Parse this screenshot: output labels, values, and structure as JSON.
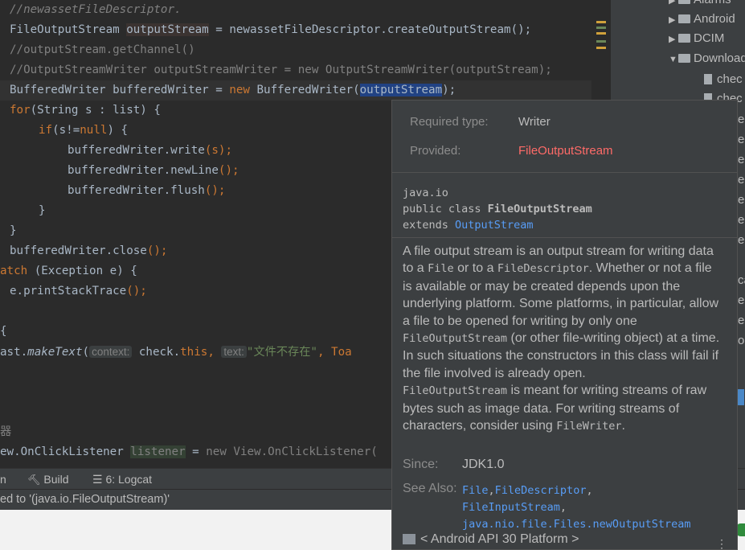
{
  "editor": {
    "l1": "//newassetFileDescriptor.",
    "l2a": "FileOutputStream ",
    "l2b": "outputStream",
    "l2c": " = newassetFileDescriptor.",
    "l2d": "createOutputStream",
    "l2e": "();",
    "l3": "//outputStream.getChannel()",
    "l4": "//OutputStreamWriter outputStreamWriter = new OutputStreamWriter(outputStream);",
    "l5a": "BufferedWriter bufferedWriter = ",
    "l5b": "new",
    "l5c": " BufferedWriter(",
    "l5d": "outputStream",
    "l5e": ");",
    "l6a": "for",
    "l6b": "(String s : list) {",
    "l7a": "if",
    "l7b": "(s!=",
    "l7c": "null",
    "l7d": ") {",
    "l8a": "bufferedWriter.",
    "l8b": "write",
    "l8c": "(s);",
    "l9a": "bufferedWriter.",
    "l9b": "newLine",
    "l9c": "();",
    "l10a": "bufferedWriter.",
    "l10b": "flush",
    "l10c": "();",
    "l11": "}",
    "l12": "}",
    "l13a": "bufferedWriter.",
    "l13b": "close",
    "l13c": "();",
    "l14a": "atch",
    "l14b": " (Exception e) {",
    "l15a": "e.",
    "l15b": "printStackTrace",
    "l15c": "();",
    "l16": "{",
    "l17a": "ast.",
    "l17b": "makeText",
    "l17c": "(",
    "l17hint1": "context:",
    "l17d": " check.",
    "l17e": "this",
    "l17f": ",",
    "l17hint2": "text:",
    "l17g": "\"文件不存在\"",
    "l17h": ", Toa",
    "l18": "器",
    "l19a": "ew.OnClickListener ",
    "l19b": "listener",
    "l19c": " = ",
    "l19d": "new View.OnClickListener(",
    "gutter_colors": [
      "#d0a13b",
      "#6a8759",
      "#d0a13b",
      "#6a8759"
    ]
  },
  "sidebar": {
    "items": [
      {
        "label": "Alarms",
        "type": "folder"
      },
      {
        "label": "Android",
        "type": "folder"
      },
      {
        "label": "DCIM",
        "type": "folder"
      },
      {
        "label": "Download",
        "type": "folder-open"
      },
      {
        "label": "chec",
        "type": "file"
      },
      {
        "label": "chec",
        "type": "file"
      }
    ],
    "partial": [
      "ec",
      "ec",
      "ec",
      "ec",
      "ec",
      "ec",
      "ec",
      "ec",
      "ec",
      "ec",
      "ca",
      "es",
      "es",
      "or"
    ]
  },
  "toolbar": {
    "run_label": "n",
    "build_label": "Build",
    "logcat_label": "6: Logcat"
  },
  "status": {
    "text": "ed to '(java.io.FileOutputStream)'"
  },
  "popup": {
    "required_label": "Required type:",
    "required_value": "Writer",
    "provided_label": "Provided:",
    "provided_value": "FileOutputStream",
    "provided_color": "#ff6b68",
    "package": "java.io",
    "decl_prefix": "public class ",
    "decl_name": "FileOutputStream",
    "extends_prefix": "extends ",
    "extends_name": "OutputStream",
    "d1": "A file output stream is an output stream for writing data to a ",
    "d1c1": "File",
    "d2": " or to a ",
    "d2c": "FileDescriptor",
    "d3": ". Whether or not a file is available or may be created depends upon the underlying platform. Some platforms, in particular, allow a file to be opened for writing by only one ",
    "d3c": "FileOutputStream",
    "d4": " (or other file-writing object) at a time. In such situations the constructors in this class will fail if the file involved is already open.",
    "d5c": "FileOutputStream",
    "d5": " is meant for writing streams of raw bytes such as image data. For writing streams of characters, consider using ",
    "d5c2": "FileWriter",
    "d6": ".",
    "since_label": "Since:",
    "since_value": "JDK1.0",
    "seealso_label": "See Also:",
    "see1": "File",
    "see2": "FileDescriptor",
    "see3": "FileInputStream",
    "see4": "java.nio.file.Files.newOutputStream",
    "platform": "< Android API 30 Platform >",
    "link_color": "#589df6"
  }
}
